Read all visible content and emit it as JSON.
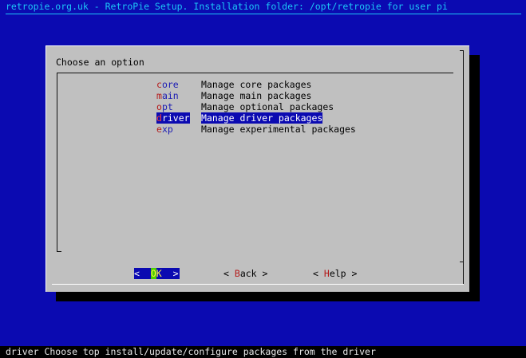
{
  "header": {
    "backtitle": "retropie.org.uk - RetroPie Setup. Installation folder: /opt/retropie for user pi"
  },
  "dialog": {
    "prompt": "Choose an option",
    "menu": {
      "items": [
        {
          "tag_hot": "c",
          "tag_rest": "ore",
          "description": "Manage core packages",
          "selected": false
        },
        {
          "tag_hot": "m",
          "tag_rest": "ain",
          "description": "Manage main packages",
          "selected": false
        },
        {
          "tag_hot": "o",
          "tag_rest": "pt",
          "description": "Manage optional packages",
          "selected": false
        },
        {
          "tag_hot": "d",
          "tag_rest": "river",
          "description": "Manage driver packages",
          "selected": true
        },
        {
          "tag_hot": "e",
          "tag_rest": "xp",
          "description": "Manage experimental packages",
          "selected": false
        }
      ]
    },
    "buttons": {
      "ok": {
        "left": "<",
        "pad": " ",
        "hot": "O",
        "rest": "K",
        "right": ">"
      },
      "back": {
        "left": "<",
        "hot": "B",
        "rest": "ack",
        "right": ">"
      },
      "help": {
        "left": "<",
        "hot": "H",
        "rest": "elp",
        "right": ">"
      }
    }
  },
  "status": {
    "text": "driver Choose top install/update/configure packages from the driver"
  },
  "colors": {
    "background": "#0b0ab1",
    "backtitle": "#1dc6f7",
    "dialog": "#c0c0c0",
    "selection": "#0b0ab1",
    "hotkey": "#b41a1a"
  }
}
